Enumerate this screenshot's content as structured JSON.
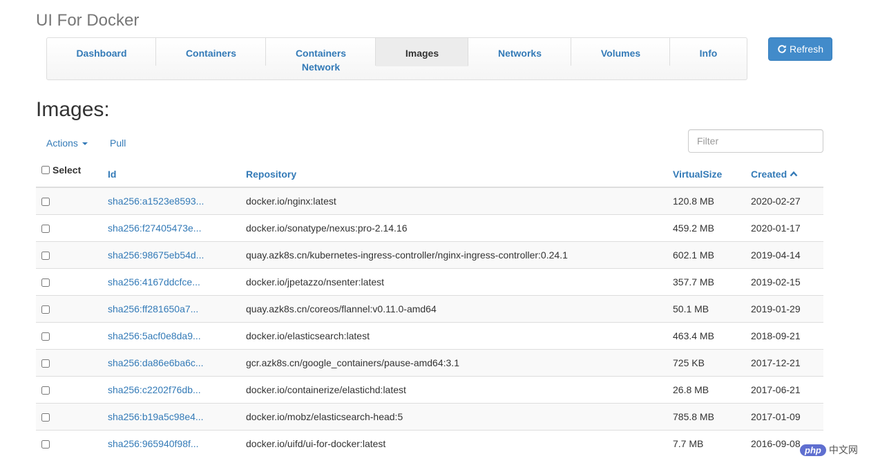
{
  "app": {
    "title": "UI For Docker"
  },
  "nav": {
    "items": [
      {
        "label": "Dashboard"
      },
      {
        "label": "Containers"
      },
      {
        "label": "Containers Network"
      },
      {
        "label": "Images"
      },
      {
        "label": "Networks"
      },
      {
        "label": "Volumes"
      },
      {
        "label": "Info"
      }
    ],
    "active": "Images"
  },
  "refresh": {
    "label": "Refresh",
    "icon": "refresh-icon"
  },
  "page": {
    "heading": "Images:"
  },
  "toolbar": {
    "actions_label": "Actions",
    "pull_label": "Pull"
  },
  "filter": {
    "placeholder": "Filter",
    "value": ""
  },
  "table": {
    "headers": {
      "select": "Select",
      "id": "Id",
      "repository": "Repository",
      "virtual_size": "VirtualSize",
      "created": "Created"
    },
    "sort": {
      "column": "Created",
      "direction": "ascending"
    },
    "rows": [
      {
        "id": "sha256:a1523e8593...",
        "repository": "docker.io/nginx:latest",
        "virtual_size": "120.8 MB",
        "created": "2020-02-27"
      },
      {
        "id": "sha256:f27405473e...",
        "repository": "docker.io/sonatype/nexus:pro-2.14.16",
        "virtual_size": "459.2 MB",
        "created": "2020-01-17"
      },
      {
        "id": "sha256:98675eb54d...",
        "repository": "quay.azk8s.cn/kubernetes-ingress-controller/nginx-ingress-controller:0.24.1",
        "virtual_size": "602.1 MB",
        "created": "2019-04-14"
      },
      {
        "id": "sha256:4167ddcfce...",
        "repository": "docker.io/jpetazzo/nsenter:latest",
        "virtual_size": "357.7 MB",
        "created": "2019-02-15"
      },
      {
        "id": "sha256:ff281650a7...",
        "repository": "quay.azk8s.cn/coreos/flannel:v0.11.0-amd64",
        "virtual_size": "50.1 MB",
        "created": "2019-01-29"
      },
      {
        "id": "sha256:5acf0e8da9...",
        "repository": "docker.io/elasticsearch:latest",
        "virtual_size": "463.4 MB",
        "created": "2018-09-21"
      },
      {
        "id": "sha256:da86e6ba6c...",
        "repository": "gcr.azk8s.cn/google_containers/pause-amd64:3.1",
        "virtual_size": "725 KB",
        "created": "2017-12-21"
      },
      {
        "id": "sha256:c2202f76db...",
        "repository": "docker.io/containerize/elastichd:latest",
        "virtual_size": "26.8 MB",
        "created": "2017-06-21"
      },
      {
        "id": "sha256:b19a5c98e4...",
        "repository": "docker.io/mobz/elasticsearch-head:5",
        "virtual_size": "785.8 MB",
        "created": "2017-01-09"
      },
      {
        "id": "sha256:965940f98f...",
        "repository": "docker.io/uifd/ui-for-docker:latest",
        "virtual_size": "7.7 MB",
        "created": "2016-09-08"
      }
    ]
  },
  "watermark": {
    "badge": "php",
    "text": "中文网"
  },
  "colors": {
    "link": "#337ab7",
    "button": "#428bca",
    "stripe": "#f9f9f9",
    "border": "#dddddd"
  }
}
